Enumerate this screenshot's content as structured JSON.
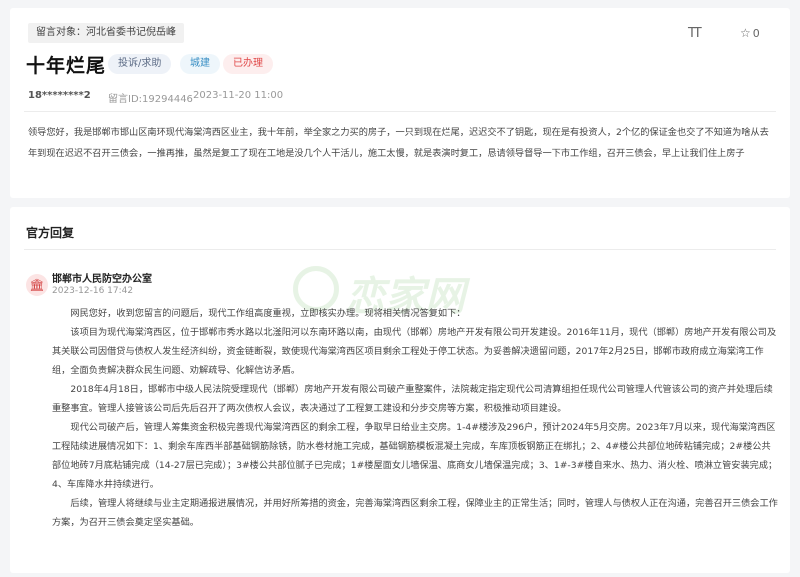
{
  "message": {
    "target_label": "留言对象：河北省委书记倪岳峰",
    "title": "十年烂尾",
    "tags": {
      "type": "投诉/求助",
      "field": "城建",
      "status": "已办理"
    },
    "author": "18********2",
    "id_text": "留言ID:19294446",
    "time": "2023-11-20 11:00",
    "like_count": "0",
    "font_size_icon": "TT",
    "star_icon_glyph": "☆",
    "body": "领导您好，我是邯郸市邯山区南环现代海棠湾西区业主，我十年前，举全家之力买的房子，一只到现在烂尾，迟迟交不了钥匙，现在是有投资人，2个亿的保证金也交了不知道为啥从去年到现在迟迟不召开三债会，一推再推，虽然是复工了现在工地是没几个人干活儿，施工太慢，就是表演时复工，恳请领导督导一下市工作组，召开三债会，早上让我们住上房子"
  },
  "reply": {
    "heading": "官方回复",
    "org_name": "邯郸市人民防空办公室",
    "org_icon_glyph": "🏛",
    "time": "2023-12-16 17:42",
    "paragraphs": [
      "网民您好，收到您留言的问题后，现代工作组高度重视，立即核实办理。现将相关情况答复如下：",
      "该项目为现代海棠湾西区，位于邯郸市秀水路以北滏阳河以东南环路以南，由现代（邯郸）房地产开发有限公司开发建设。2016年11月，现代（邯郸）房地产开发有限公司及其关联公司因借贷与债权人发生经济纠纷，资金链断裂，致使现代海棠湾西区项目剩余工程处于停工状态。为妥善解决遗留问题，2017年2月25日，邯郸市政府成立海棠湾工作组，全面负责解决群众民生问题、劝解疏导、化解信访矛盾。",
      "2018年4月18日，邯郸市中级人民法院受理现代（邯郸）房地产开发有限公司破产重整案件，法院裁定指定现代公司清算组担任现代公司管理人代管该公司的资产并处理后续重整事宜。管理人接管该公司后先后召开了两次债权人会议，表决通过了工程复工建设和分步交房等方案，积极推动项目建设。",
      "现代公司破产后，管理人筹集资金积极完善现代海棠湾西区的剩余工程，争取早日给业主交房。1-4#楼涉及296户，预计2024年5月交房。2023年7月以来，现代海棠湾西区工程陆续进展情况如下：1、剩余车库西半部基础钢筋除锈，防水卷材施工完成，基础钢筋模板混凝土完成，车库顶板钢筋正在绑扎；2、4#楼公共部位地砖粘铺完成；2#楼公共部位地砖7月底粘铺完成（14-27层已完成）；3#楼公共部位腻子已完成；1#楼屋面女儿墙保温、底商女儿墙保温完成；3、1#-3#楼自来水、热力、消火栓、喷淋立管安装完成；4、车库降水井持续进行。",
      "后续，管理人将继续与业主定期通报进展情况，并用好所筹措的资金，完善海棠湾西区剩余工程，保障业主的正常生活；同时，管理人与债权人正在沟通，完善召开三债会工作方案，为召开三债会奠定坚实基础。"
    ]
  },
  "watermark": {
    "text": "恋家网",
    "color": "#3fa52f"
  }
}
